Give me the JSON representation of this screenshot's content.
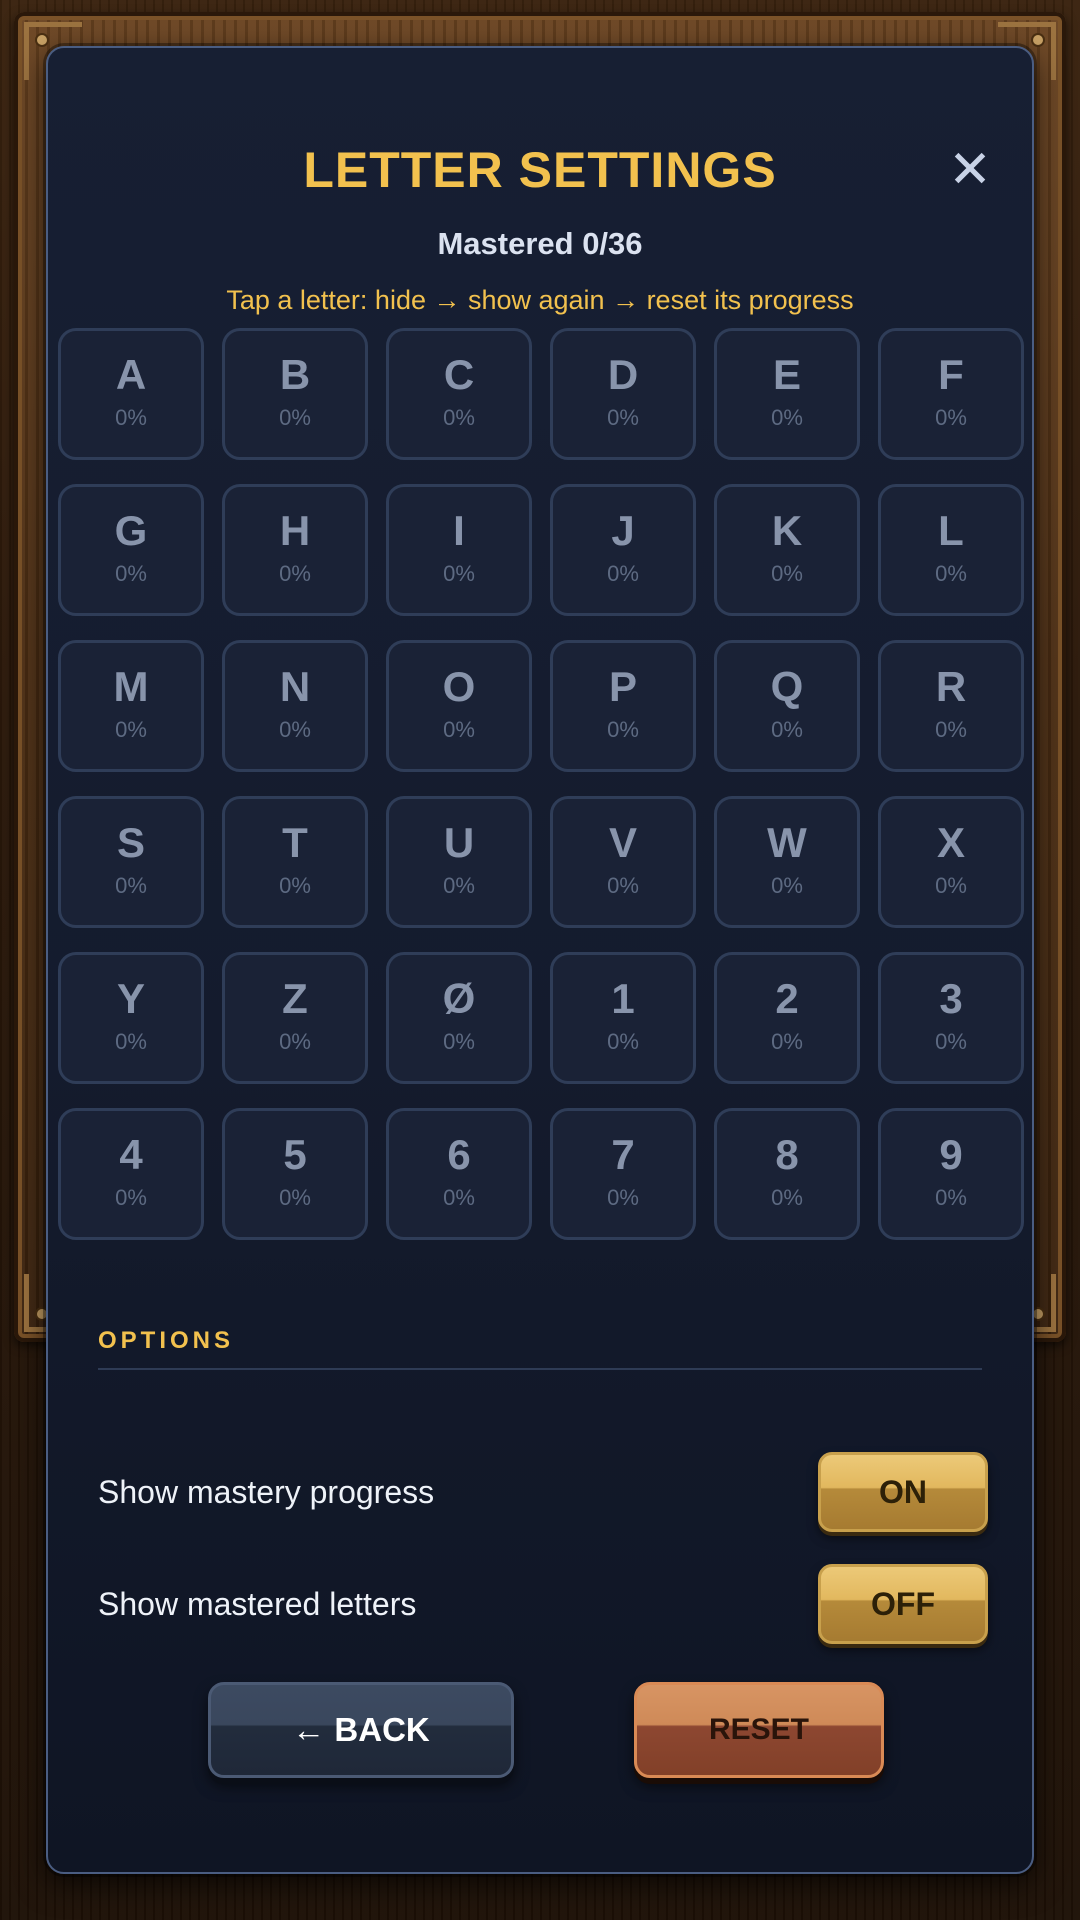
{
  "dialog": {
    "title": "LETTER SETTINGS",
    "close_glyph": "✕",
    "mastered": "Mastered 0/36",
    "hint": "Tap a letter: hide → show again → reset its progress"
  },
  "letters": [
    {
      "char": "A",
      "progress": "0%"
    },
    {
      "char": "B",
      "progress": "0%"
    },
    {
      "char": "C",
      "progress": "0%"
    },
    {
      "char": "D",
      "progress": "0%"
    },
    {
      "char": "E",
      "progress": "0%"
    },
    {
      "char": "F",
      "progress": "0%"
    },
    {
      "char": "G",
      "progress": "0%"
    },
    {
      "char": "H",
      "progress": "0%"
    },
    {
      "char": "I",
      "progress": "0%"
    },
    {
      "char": "J",
      "progress": "0%"
    },
    {
      "char": "K",
      "progress": "0%"
    },
    {
      "char": "L",
      "progress": "0%"
    },
    {
      "char": "M",
      "progress": "0%"
    },
    {
      "char": "N",
      "progress": "0%"
    },
    {
      "char": "O",
      "progress": "0%"
    },
    {
      "char": "P",
      "progress": "0%"
    },
    {
      "char": "Q",
      "progress": "0%"
    },
    {
      "char": "R",
      "progress": "0%"
    },
    {
      "char": "S",
      "progress": "0%"
    },
    {
      "char": "T",
      "progress": "0%"
    },
    {
      "char": "U",
      "progress": "0%"
    },
    {
      "char": "V",
      "progress": "0%"
    },
    {
      "char": "W",
      "progress": "0%"
    },
    {
      "char": "X",
      "progress": "0%"
    },
    {
      "char": "Y",
      "progress": "0%"
    },
    {
      "char": "Z",
      "progress": "0%"
    },
    {
      "char": "Ø",
      "progress": "0%"
    },
    {
      "char": "1",
      "progress": "0%"
    },
    {
      "char": "2",
      "progress": "0%"
    },
    {
      "char": "3",
      "progress": "0%"
    },
    {
      "char": "4",
      "progress": "0%"
    },
    {
      "char": "5",
      "progress": "0%"
    },
    {
      "char": "6",
      "progress": "0%"
    },
    {
      "char": "7",
      "progress": "0%"
    },
    {
      "char": "8",
      "progress": "0%"
    },
    {
      "char": "9",
      "progress": "0%"
    }
  ],
  "options": {
    "heading": "OPTIONS",
    "items": [
      {
        "label": "Show mastery progress",
        "value": "ON"
      },
      {
        "label": "Show mastered letters",
        "value": "OFF"
      }
    ]
  },
  "buttons": {
    "back": "← BACK",
    "reset": "RESET"
  },
  "colors": {
    "accent_gold": "#f2c14e",
    "panel_bg": "#151c2e",
    "tile_bg": "#1a2236",
    "reset_orange": "#cf8a58"
  }
}
